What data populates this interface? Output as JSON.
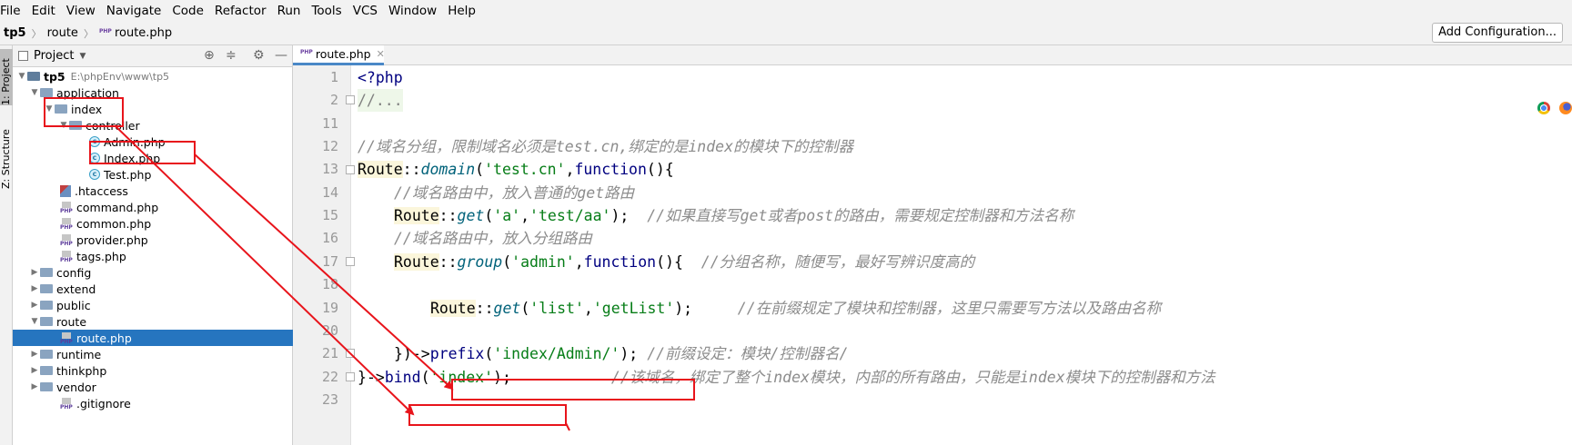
{
  "menu": [
    "File",
    "Edit",
    "View",
    "Navigate",
    "Code",
    "Refactor",
    "Run",
    "Tools",
    "VCS",
    "Window",
    "Help"
  ],
  "breadcrumb": {
    "project": "tp5",
    "folder": "route",
    "file": "route.php"
  },
  "toolbar": {
    "add_configuration": "Add Configuration..."
  },
  "toolstrip": {
    "project_tab": "1: Project",
    "structure_tab": "Z: Structure"
  },
  "project_panel": {
    "title": "Project",
    "tree": [
      {
        "label": "tp5",
        "path": "E:\\phpEnv\\www\\tp5",
        "type": "root"
      },
      {
        "label": "application",
        "type": "folder"
      },
      {
        "label": "index",
        "type": "folder"
      },
      {
        "label": "controller",
        "type": "folder"
      },
      {
        "label": "Admin.php",
        "type": "class"
      },
      {
        "label": "Index.php",
        "type": "class"
      },
      {
        "label": "Test.php",
        "type": "class"
      },
      {
        "label": ".htaccess",
        "type": "htaccess"
      },
      {
        "label": "command.php",
        "type": "php"
      },
      {
        "label": "common.php",
        "type": "php"
      },
      {
        "label": "provider.php",
        "type": "php"
      },
      {
        "label": "tags.php",
        "type": "php"
      },
      {
        "label": "config",
        "type": "folder"
      },
      {
        "label": "extend",
        "type": "folder"
      },
      {
        "label": "public",
        "type": "folder"
      },
      {
        "label": "route",
        "type": "folder"
      },
      {
        "label": "route.php",
        "type": "php"
      },
      {
        "label": "runtime",
        "type": "folder"
      },
      {
        "label": "thinkphp",
        "type": "folder"
      },
      {
        "label": "vendor",
        "type": "folder"
      },
      {
        "label": ".gitignore",
        "type": "file"
      }
    ]
  },
  "editor": {
    "tab_label": "route.php",
    "line_numbers": [
      "1",
      "2",
      "11",
      "12",
      "13",
      "14",
      "15",
      "16",
      "17",
      "18",
      "19",
      "20",
      "21",
      "22",
      "23"
    ],
    "code": {
      "l1": "<?php",
      "l2": "//...",
      "l12": "//域名分组，限制域名必须是test.cn,绑定的是index的模块下的控制器",
      "l13_cls": "Route",
      "l13_op": "::",
      "l13_fn": "domain",
      "l13_p1": "(",
      "l13_s1": "'test.cn'",
      "l13_p2": ",",
      "l13_kw": "function",
      "l13_p3": "(){",
      "l14": "//域名路由中，放入普通的get路由",
      "l15_cls": "Route",
      "l15_op": "::",
      "l15_fn": "get",
      "l15_p1": "(",
      "l15_s1": "'a'",
      "l15_p2": ",",
      "l15_s2": "'test/aa'",
      "l15_p3": ");  ",
      "l15_cm": "//如果直接写get或者post的路由，需要规定控制器和方法名称",
      "l16": "//域名路由中，放入分组路由",
      "l17_cls": "Route",
      "l17_op": "::",
      "l17_fn": "group",
      "l17_p1": "(",
      "l17_s1": "'admin'",
      "l17_p2": ",",
      "l17_kw": "function",
      "l17_p3": "(){  ",
      "l17_cm": "//分组名称，随便写，最好写辨识度高的",
      "l19_cls": "Route",
      "l19_op": "::",
      "l19_fn": "get",
      "l19_p1": "(",
      "l19_s1": "'list'",
      "l19_p2": ",",
      "l19_s2": "'getList'",
      "l19_p3": ");     ",
      "l19_cm": "//在前缀规定了模块和控制器，这里只需要写方法以及路由名称",
      "l21_p0": "})",
      "l21_arrow": "->",
      "l21_fn": "prefix",
      "l21_p1": "(",
      "l21_s1": "'index/Admin/'",
      "l21_p2": "); ",
      "l21_cm": "//前缀设定：模块/控制器名/",
      "l22_p0": "}",
      "l22_arrow": "->",
      "l22_fn": "bind",
      "l22_p1": "(",
      "l22_s1": "'index'",
      "l22_p2": ");",
      "l22_cm": "//该域名，绑定了整个index模块，内部的所有路由，只能是index模块下的控制器和方法"
    }
  },
  "colors": {
    "annotation": "#e8141b",
    "selection": "#2675bf",
    "tab_underline": "#4a88c7"
  }
}
